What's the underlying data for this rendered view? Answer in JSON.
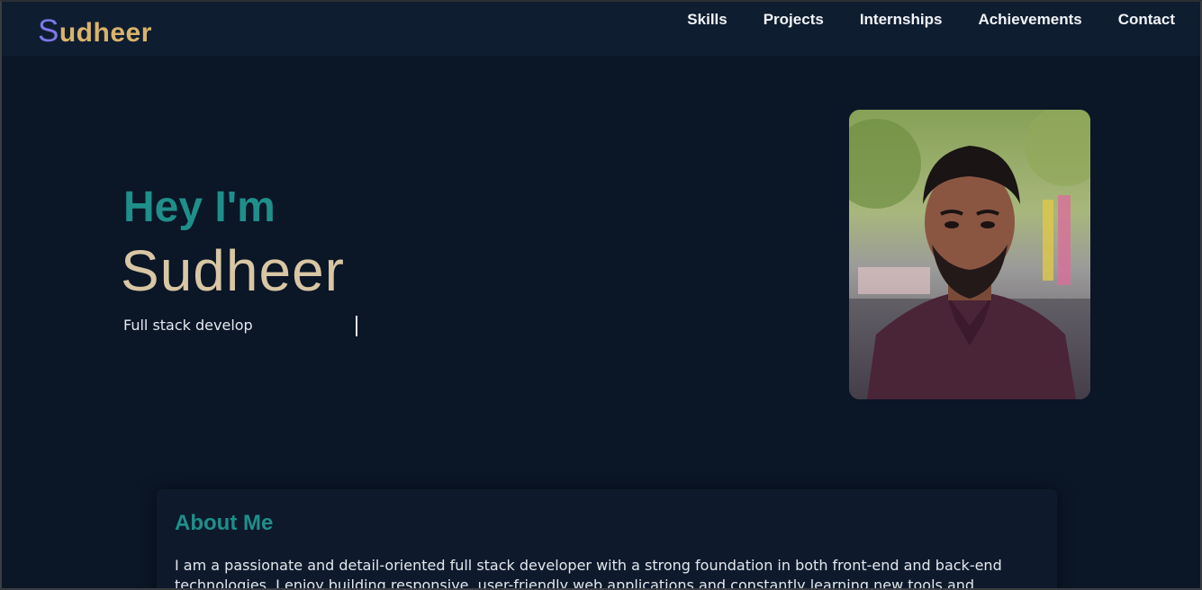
{
  "navbar": {
    "logo_first": "S",
    "logo_rest": "udheer",
    "links": [
      "Skills",
      "Projects",
      "Internships",
      "Achievements",
      "Contact"
    ]
  },
  "hero": {
    "greeting": "Hey I'm",
    "name": "Sudheer",
    "typed_text": "Full stack develop"
  },
  "about": {
    "title": "About Me",
    "text": "I am a passionate and detail-oriented full stack developer with a strong foundation in both front-end and back-end technologies. I enjoy building responsive, user-friendly web applications and constantly learning new tools and techniques to improve my craft."
  },
  "colors": {
    "background": "#0b1627",
    "navbar": "#0f1d30",
    "accent_teal": "#1f8f8a",
    "logo_purple": "#7c77e6",
    "logo_gold": "#d9b36c",
    "name_beige": "#d8c6a4"
  }
}
